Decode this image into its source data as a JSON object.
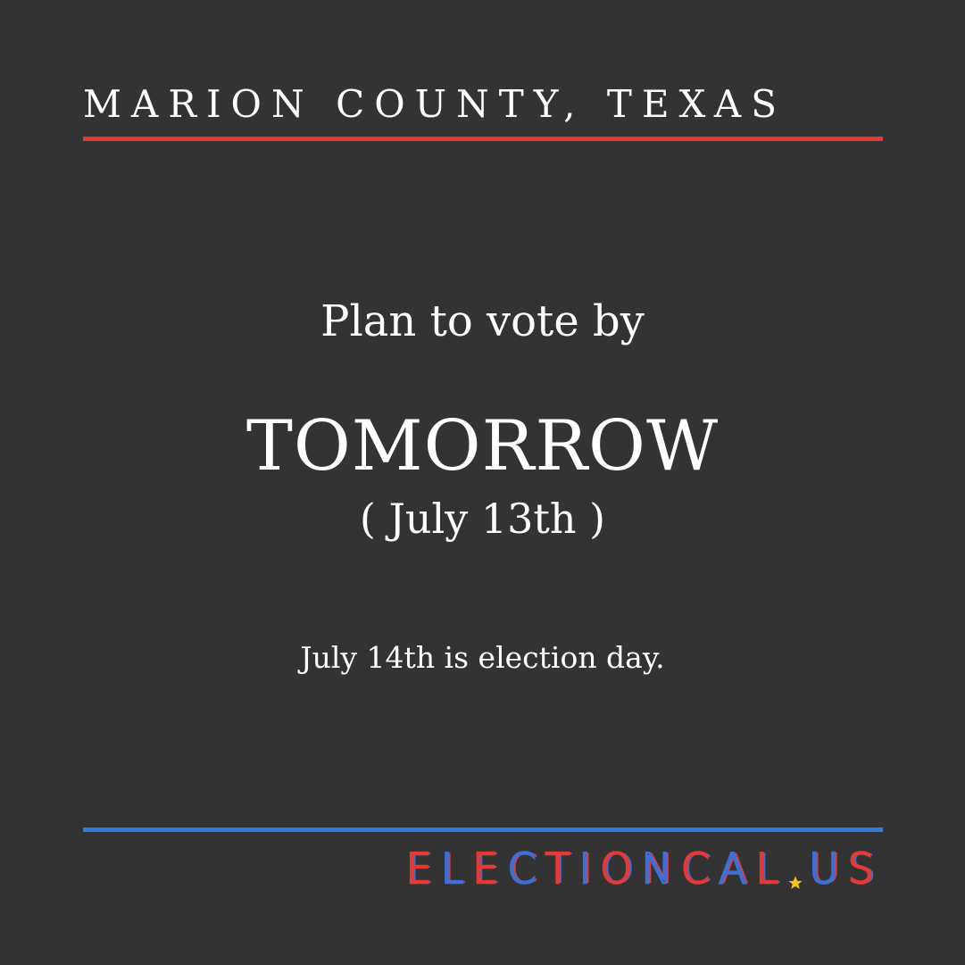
{
  "header": {
    "county": "MARION COUNTY, TEXAS"
  },
  "main": {
    "lead": "Plan to vote by",
    "deadline": "TOMORROW",
    "date": "( July 13th )",
    "note": "July 14th is election day."
  },
  "brand": {
    "name_part1": "ELECTIONCAL",
    "name_part2": "US",
    "star_icon": "star-icon"
  },
  "colors": {
    "background": "#333333",
    "top_rule": "#e53935",
    "bottom_rule": "#2f7de1",
    "brand_red": "#e53935",
    "brand_blue": "#3d6fd6",
    "star": "#f5c518"
  }
}
